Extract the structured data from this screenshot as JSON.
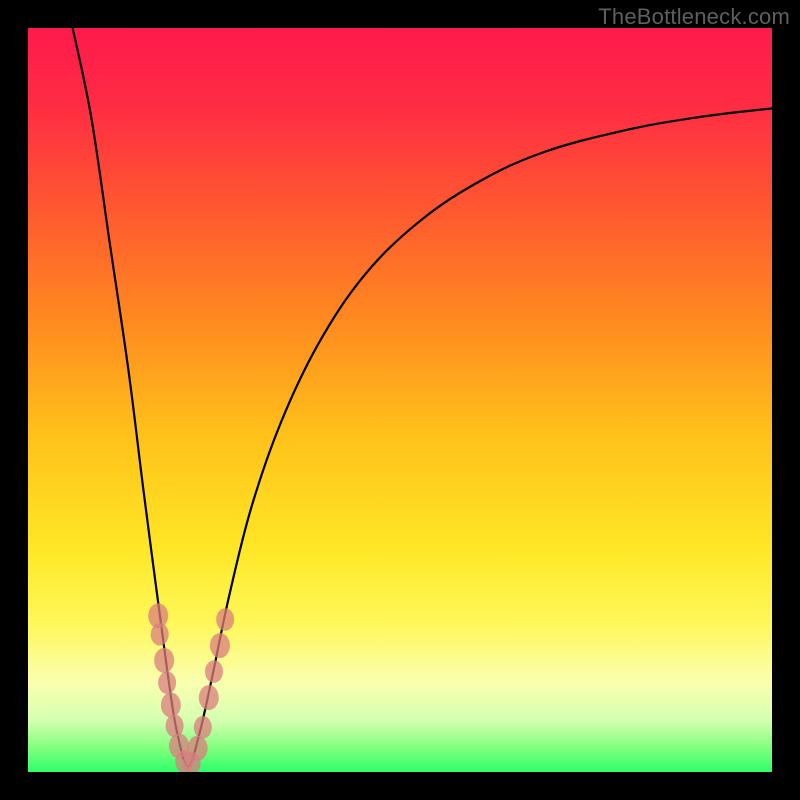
{
  "watermark": "TheBottleneck.com",
  "chart_data": {
    "type": "line",
    "title": "",
    "xlabel": "",
    "ylabel": "",
    "xlim": [
      0,
      1
    ],
    "ylim": [
      0,
      1
    ],
    "notch_x": 0.215,
    "curve": {
      "name": "bottleneck-curve",
      "points": [
        {
          "x": 0.06,
          "y": 1.0
        },
        {
          "x": 0.085,
          "y": 0.88
        },
        {
          "x": 0.11,
          "y": 0.71
        },
        {
          "x": 0.135,
          "y": 0.54
        },
        {
          "x": 0.155,
          "y": 0.38
        },
        {
          "x": 0.172,
          "y": 0.25
        },
        {
          "x": 0.188,
          "y": 0.13
        },
        {
          "x": 0.2,
          "y": 0.055
        },
        {
          "x": 0.215,
          "y": 0.008
        },
        {
          "x": 0.23,
          "y": 0.05
        },
        {
          "x": 0.248,
          "y": 0.13
        },
        {
          "x": 0.27,
          "y": 0.235
        },
        {
          "x": 0.3,
          "y": 0.355
        },
        {
          "x": 0.34,
          "y": 0.47
        },
        {
          "x": 0.39,
          "y": 0.575
        },
        {
          "x": 0.45,
          "y": 0.665
        },
        {
          "x": 0.52,
          "y": 0.735
        },
        {
          "x": 0.6,
          "y": 0.79
        },
        {
          "x": 0.69,
          "y": 0.832
        },
        {
          "x": 0.8,
          "y": 0.862
        },
        {
          "x": 0.9,
          "y": 0.88
        },
        {
          "x": 1.0,
          "y": 0.892
        }
      ]
    },
    "markers": [
      {
        "x": 0.175,
        "y": 0.21,
        "r": 10
      },
      {
        "x": 0.177,
        "y": 0.185,
        "r": 9
      },
      {
        "x": 0.183,
        "y": 0.15,
        "r": 10
      },
      {
        "x": 0.187,
        "y": 0.12,
        "r": 9
      },
      {
        "x": 0.192,
        "y": 0.09,
        "r": 10
      },
      {
        "x": 0.197,
        "y": 0.062,
        "r": 9
      },
      {
        "x": 0.203,
        "y": 0.035,
        "r": 10
      },
      {
        "x": 0.21,
        "y": 0.014,
        "r": 9
      },
      {
        "x": 0.22,
        "y": 0.012,
        "r": 9
      },
      {
        "x": 0.228,
        "y": 0.032,
        "r": 10
      },
      {
        "x": 0.235,
        "y": 0.06,
        "r": 9
      },
      {
        "x": 0.243,
        "y": 0.1,
        "r": 10
      },
      {
        "x": 0.25,
        "y": 0.135,
        "r": 9
      },
      {
        "x": 0.258,
        "y": 0.17,
        "r": 10
      },
      {
        "x": 0.265,
        "y": 0.205,
        "r": 9
      }
    ],
    "gradient_stops": [
      {
        "offset": 0.0,
        "color": "#ff1a4d"
      },
      {
        "offset": 0.1,
        "color": "#ff2b44"
      },
      {
        "offset": 0.25,
        "color": "#ff5a2f"
      },
      {
        "offset": 0.4,
        "color": "#ff8c1f"
      },
      {
        "offset": 0.55,
        "color": "#ffc21a"
      },
      {
        "offset": 0.7,
        "color": "#ffe726"
      },
      {
        "offset": 0.8,
        "color": "#fff85a"
      },
      {
        "offset": 0.88,
        "color": "#faffb0"
      },
      {
        "offset": 0.93,
        "color": "#d6ffb0"
      },
      {
        "offset": 0.97,
        "color": "#7cff7c"
      },
      {
        "offset": 1.0,
        "color": "#2dff6d"
      }
    ]
  }
}
